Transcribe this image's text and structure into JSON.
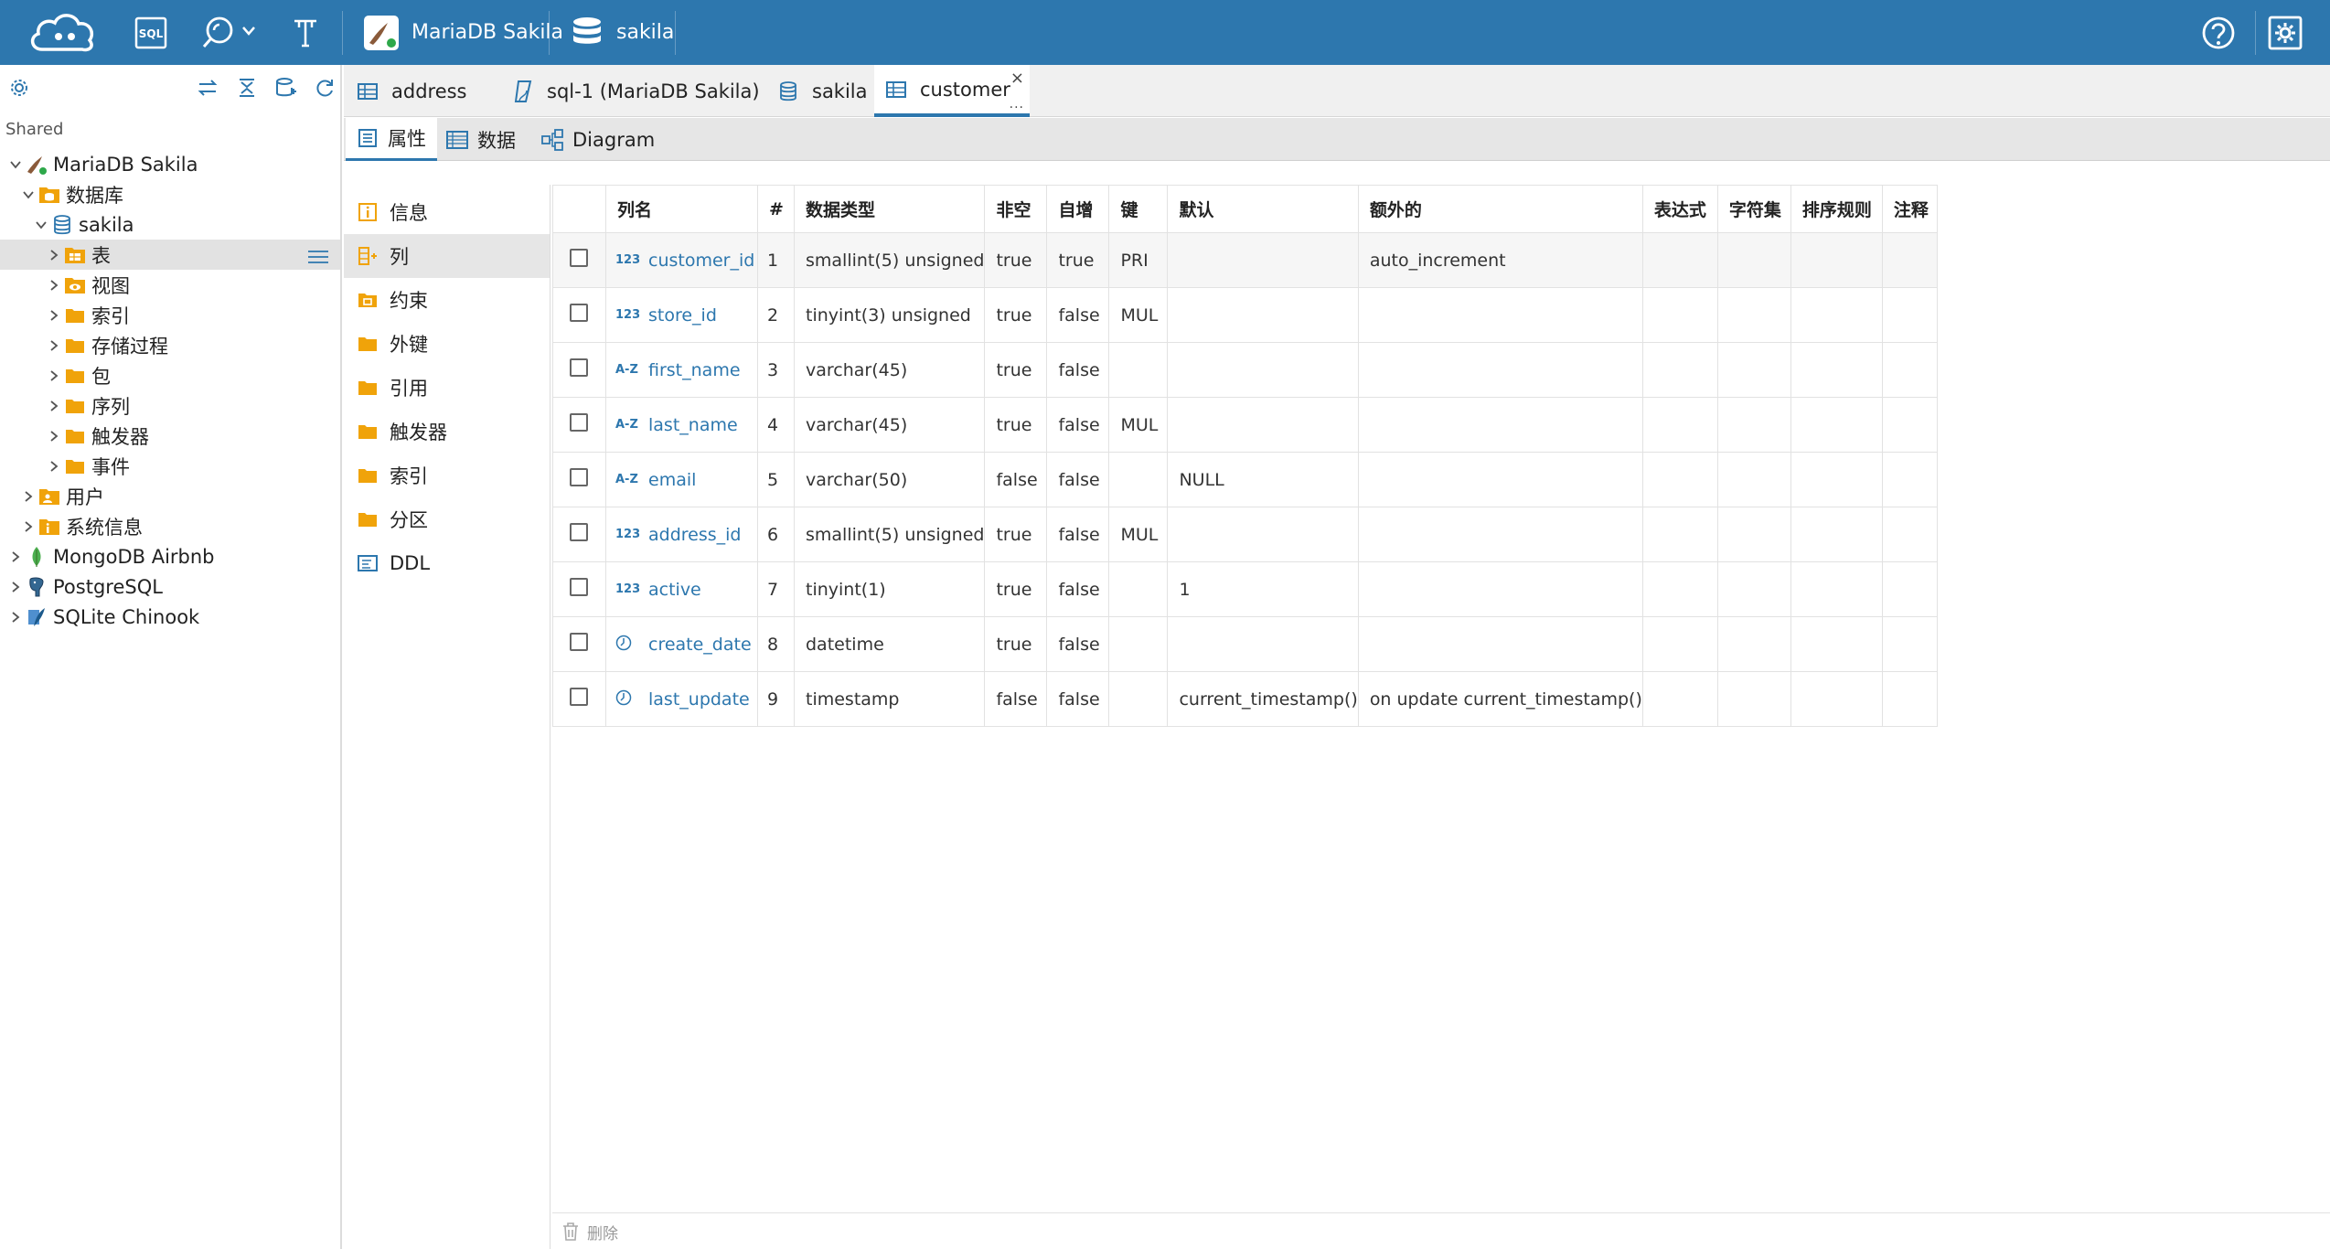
{
  "toolbar": {
    "connection_label": "MariaDB Sakila",
    "database_label": "sakila",
    "sql_icon_text": "SQL"
  },
  "navigator": {
    "shared_label": "Shared",
    "tree": [
      {
        "label": "MariaDB Sakila",
        "level": 0,
        "expanded": true,
        "icon": "mariadb-icon"
      },
      {
        "label": "数据库",
        "level": 1,
        "expanded": true,
        "icon": "database-folder-icon"
      },
      {
        "label": "sakila",
        "level": 2,
        "expanded": true,
        "icon": "database-icon"
      },
      {
        "label": "表",
        "level": 3,
        "expanded": false,
        "icon": "table-folder-icon",
        "selected": true
      },
      {
        "label": "视图",
        "level": 3,
        "expanded": false,
        "icon": "view-folder-icon"
      },
      {
        "label": "索引",
        "level": 3,
        "expanded": false,
        "icon": "folder-icon"
      },
      {
        "label": "存储过程",
        "level": 3,
        "expanded": false,
        "icon": "folder-icon"
      },
      {
        "label": "包",
        "level": 3,
        "expanded": false,
        "icon": "folder-icon"
      },
      {
        "label": "序列",
        "level": 3,
        "expanded": false,
        "icon": "folder-icon"
      },
      {
        "label": "触发器",
        "level": 3,
        "expanded": false,
        "icon": "folder-icon"
      },
      {
        "label": "事件",
        "level": 3,
        "expanded": false,
        "icon": "folder-icon"
      },
      {
        "label": "用户",
        "level": 1,
        "expanded": false,
        "icon": "users-folder-icon"
      },
      {
        "label": "系统信息",
        "level": 1,
        "expanded": false,
        "icon": "info-folder-icon"
      },
      {
        "label": "MongoDB Airbnb",
        "level": 0,
        "expanded": false,
        "icon": "mongodb-icon"
      },
      {
        "label": "PostgreSQL",
        "level": 0,
        "expanded": false,
        "icon": "postgresql-icon"
      },
      {
        "label": "SQLite Chinook",
        "level": 0,
        "expanded": false,
        "icon": "sqlite-icon"
      }
    ]
  },
  "tabs": [
    {
      "label": "address",
      "icon": "table-icon",
      "active": false
    },
    {
      "label": "sql-1 (MariaDB Sakila)",
      "icon": "sql-script-icon",
      "active": false
    },
    {
      "label": "sakila",
      "icon": "database-icon",
      "active": false
    },
    {
      "label": "customer",
      "icon": "table-icon",
      "active": true
    }
  ],
  "tab_close": "×",
  "tab_more": "...",
  "subtabs": [
    {
      "label": "属性",
      "icon": "properties-icon",
      "active": true
    },
    {
      "label": "数据",
      "icon": "data-grid-icon",
      "active": false
    },
    {
      "label": "Diagram",
      "icon": "diagram-icon",
      "active": false
    }
  ],
  "props_menu": [
    {
      "label": "信息",
      "icon": "info-icon",
      "active": false
    },
    {
      "label": "列",
      "icon": "columns-icon",
      "active": true
    },
    {
      "label": "约束",
      "icon": "constraint-folder-icon",
      "active": false
    },
    {
      "label": "外键",
      "icon": "folder-icon",
      "active": false
    },
    {
      "label": "引用",
      "icon": "folder-icon",
      "active": false
    },
    {
      "label": "触发器",
      "icon": "folder-icon",
      "active": false
    },
    {
      "label": "索引",
      "icon": "folder-icon",
      "active": false
    },
    {
      "label": "分区",
      "icon": "folder-icon",
      "active": false
    },
    {
      "label": "DDL",
      "icon": "ddl-icon",
      "active": false
    }
  ],
  "grid": {
    "headers": [
      "列名",
      "#",
      "数据类型",
      "非空",
      "自增",
      "键",
      "默认",
      "额外的",
      "表达式",
      "字符集",
      "排序规则",
      "注释"
    ],
    "rows": [
      {
        "type_icon": "123",
        "name": "customer_id",
        "num": "1",
        "dtype": "smallint(5) unsigned",
        "notnull": "true",
        "autoinc": "true",
        "key": "PRI",
        "default": "",
        "extra": "auto_increment",
        "expr": "",
        "charset": "",
        "collation": "",
        "comment": ""
      },
      {
        "type_icon": "123",
        "name": "store_id",
        "num": "2",
        "dtype": "tinyint(3) unsigned",
        "notnull": "true",
        "autoinc": "false",
        "key": "MUL",
        "default": "",
        "extra": "",
        "expr": "",
        "charset": "",
        "collation": "",
        "comment": ""
      },
      {
        "type_icon": "A-Z",
        "name": "first_name",
        "num": "3",
        "dtype": "varchar(45)",
        "notnull": "true",
        "autoinc": "false",
        "key": "",
        "default": "",
        "extra": "",
        "expr": "",
        "charset": "",
        "collation": "",
        "comment": ""
      },
      {
        "type_icon": "A-Z",
        "name": "last_name",
        "num": "4",
        "dtype": "varchar(45)",
        "notnull": "true",
        "autoinc": "false",
        "key": "MUL",
        "default": "",
        "extra": "",
        "expr": "",
        "charset": "",
        "collation": "",
        "comment": ""
      },
      {
        "type_icon": "A-Z",
        "name": "email",
        "num": "5",
        "dtype": "varchar(50)",
        "notnull": "false",
        "autoinc": "false",
        "key": "",
        "default": "NULL",
        "extra": "",
        "expr": "",
        "charset": "",
        "collation": "",
        "comment": ""
      },
      {
        "type_icon": "123",
        "name": "address_id",
        "num": "6",
        "dtype": "smallint(5) unsigned",
        "notnull": "true",
        "autoinc": "false",
        "key": "MUL",
        "default": "",
        "extra": "",
        "expr": "",
        "charset": "",
        "collation": "",
        "comment": ""
      },
      {
        "type_icon": "123",
        "name": "active",
        "num": "7",
        "dtype": "tinyint(1)",
        "notnull": "true",
        "autoinc": "false",
        "key": "",
        "default": "1",
        "extra": "",
        "expr": "",
        "charset": "",
        "collation": "",
        "comment": ""
      },
      {
        "type_icon": "clock",
        "name": "create_date",
        "num": "8",
        "dtype": "datetime",
        "notnull": "true",
        "autoinc": "false",
        "key": "",
        "default": "",
        "extra": "",
        "expr": "",
        "charset": "",
        "collation": "",
        "comment": ""
      },
      {
        "type_icon": "clock",
        "name": "last_update",
        "num": "9",
        "dtype": "timestamp",
        "notnull": "false",
        "autoinc": "false",
        "key": "",
        "default": "current_timestamp()",
        "extra": "on update current_timestamp()",
        "expr": "",
        "charset": "",
        "collation": "",
        "comment": ""
      }
    ]
  },
  "footer": {
    "delete_label": "删除"
  },
  "colors": {
    "toolbar": "#2d77ae",
    "accent": "#2d77ae",
    "folder": "#f0a30a",
    "mongodb": "#4caf50"
  }
}
